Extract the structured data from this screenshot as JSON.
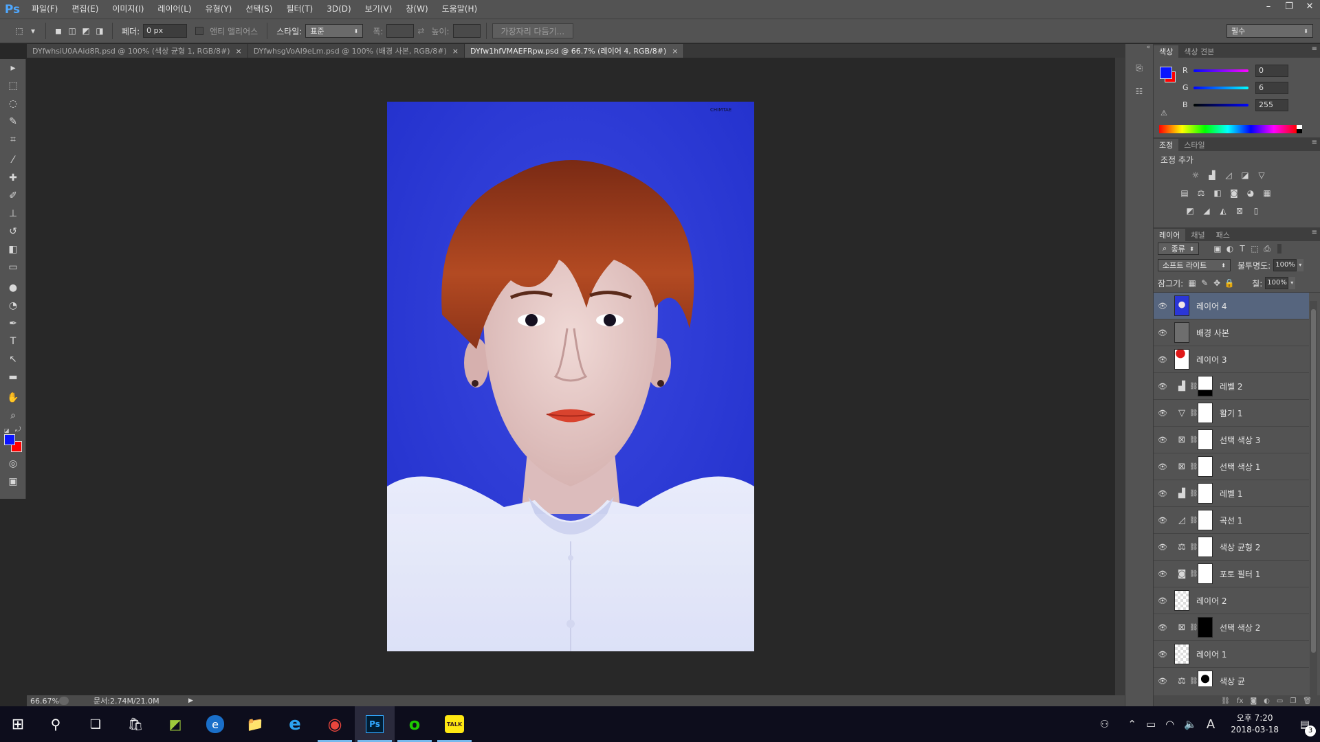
{
  "app": {
    "logo": "Ps",
    "menu": [
      "파일(F)",
      "편집(E)",
      "이미지(I)",
      "레이어(L)",
      "유형(Y)",
      "선택(S)",
      "필터(T)",
      "3D(D)",
      "보기(V)",
      "창(W)",
      "도움말(H)"
    ],
    "window_controls": {
      "minimize": "–",
      "restore": "❐",
      "close": "✕"
    }
  },
  "options_bar": {
    "feather_label": "페더:",
    "feather_value": "0 px",
    "antialias_label": "앤티 앨리어스",
    "style_label": "스타일:",
    "style_value": "표준",
    "width_label": "폭:",
    "height_label": "높이:",
    "refine_edge_button": "가장자리 다듬기...",
    "workspace_value": "필수"
  },
  "tools": [
    {
      "name": "move-tool-icon",
      "glyph": "▸"
    },
    {
      "name": "marquee-tool-icon",
      "glyph": "⬚"
    },
    {
      "name": "lasso-tool-icon",
      "glyph": "◌"
    },
    {
      "name": "quick-select-tool-icon",
      "glyph": "✎"
    },
    {
      "name": "crop-tool-icon",
      "glyph": "⌗"
    },
    {
      "name": "eyedropper-tool-icon",
      "glyph": "⁄"
    },
    {
      "name": "healing-brush-tool-icon",
      "glyph": "✚"
    },
    {
      "name": "brush-tool-icon",
      "glyph": "✐"
    },
    {
      "name": "stamp-tool-icon",
      "glyph": "⊥"
    },
    {
      "name": "history-brush-tool-icon",
      "glyph": "↺"
    },
    {
      "name": "eraser-tool-icon",
      "glyph": "◧"
    },
    {
      "name": "gradient-tool-icon",
      "glyph": "▭"
    },
    {
      "name": "blur-tool-icon",
      "glyph": "●"
    },
    {
      "name": "dodge-tool-icon",
      "glyph": "◔"
    },
    {
      "name": "pen-tool-icon",
      "glyph": "✒"
    },
    {
      "name": "type-tool-icon",
      "glyph": "T"
    },
    {
      "name": "path-select-tool-icon",
      "glyph": "↖"
    },
    {
      "name": "shape-tool-icon",
      "glyph": "▬"
    },
    {
      "name": "hand-tool-icon",
      "glyph": "✋"
    },
    {
      "name": "zoom-tool-icon",
      "glyph": "⌕"
    }
  ],
  "colors": {
    "foreground": "#0a14ff",
    "background": "#ff0000",
    "accent": "#56657e"
  },
  "tabs": [
    {
      "title": "DYfwhsiU0AAid8R.psd @ 100% (색상 균형 1, RGB/8#)",
      "close": "×",
      "active": false
    },
    {
      "title": "DYfwhsgVoAI9eLm.psd @ 100% (배경 사본, RGB/8#)",
      "close": "×",
      "active": false
    },
    {
      "title": "DYfw1hfVMAEFRpw.psd @ 66.7% (레이어 4, RGB/8#)",
      "close": "×",
      "active": true
    }
  ],
  "image": {
    "watermark": "CHIMTAE"
  },
  "status": {
    "zoom": "66.67%",
    "doc_info": "문서:2.74M/21.0M"
  },
  "color_panel": {
    "tabs": [
      "색상",
      "색상 견본"
    ],
    "r_label": "R",
    "r_value": "0",
    "g_label": "G",
    "g_value": "6",
    "b_label": "B",
    "b_value": "255"
  },
  "adjust_panel": {
    "tabs": [
      "조정",
      "스타일"
    ],
    "title": "조정 추가"
  },
  "layers_panel": {
    "tabs": [
      "레이어",
      "채널",
      "패스"
    ],
    "filter_label": "종류",
    "blend_mode": "소프트 라이트",
    "opacity_label": "불투명도:",
    "opacity_value": "100%",
    "lock_label": "잠그기:",
    "fill_label": "칠:",
    "fill_value": "100%",
    "layers": [
      {
        "name": "레이어 4",
        "kind": "image-portrait",
        "selected": true
      },
      {
        "name": "배경 사본",
        "kind": "image-gray",
        "selected": false
      },
      {
        "name": "레이어 3",
        "kind": "image-red",
        "selected": false
      },
      {
        "name": "레벨 2",
        "kind": "adj-levels",
        "mask": "white-black",
        "selected": false
      },
      {
        "name": "활기 1",
        "kind": "adj-vibrance",
        "mask": "white",
        "selected": false
      },
      {
        "name": "선택 색상 3",
        "kind": "adj-selective",
        "mask": "white",
        "selected": false
      },
      {
        "name": "선택 색상 1",
        "kind": "adj-selective",
        "mask": "white",
        "selected": false
      },
      {
        "name": "레벨 1",
        "kind": "adj-levels",
        "mask": "white",
        "selected": false
      },
      {
        "name": "곡선 1",
        "kind": "adj-curves",
        "mask": "white",
        "selected": false
      },
      {
        "name": "색상 균형 2",
        "kind": "adj-balance",
        "mask": "white",
        "selected": false
      },
      {
        "name": "포토 필터 1",
        "kind": "adj-photo",
        "mask": "white",
        "selected": false
      },
      {
        "name": "레이어 2",
        "kind": "image-transparent",
        "selected": false
      },
      {
        "name": "선택 색상 2",
        "kind": "adj-selective",
        "mask": "black",
        "selected": false
      },
      {
        "name": "레이어 1",
        "kind": "image-transparent",
        "selected": false
      },
      {
        "name": "색상 균",
        "kind": "adj-balance",
        "mask": "portrait",
        "selected": false
      }
    ]
  },
  "taskbar": {
    "time": "오후 7:20",
    "date": "2018-03-18",
    "ime": "A",
    "notification_count": "3",
    "apps": [
      {
        "name": "start-button",
        "glyph": "⊞"
      },
      {
        "name": "search-icon",
        "glyph": "⚲"
      },
      {
        "name": "task-view-icon",
        "glyph": "❏"
      },
      {
        "name": "store-icon",
        "glyph": "🛍"
      },
      {
        "name": "nvidia-icon",
        "glyph": "◩"
      },
      {
        "name": "edge-icon",
        "glyph": "e"
      },
      {
        "name": "file-explorer-icon",
        "glyph": "📁"
      },
      {
        "name": "internet-explorer-icon",
        "glyph": "e"
      },
      {
        "name": "chrome-icon",
        "glyph": "◉"
      },
      {
        "name": "photoshop-icon",
        "glyph": "Ps"
      },
      {
        "name": "messenger-icon",
        "glyph": "o"
      },
      {
        "name": "kakaotalk-icon",
        "glyph": "TALK"
      }
    ]
  }
}
